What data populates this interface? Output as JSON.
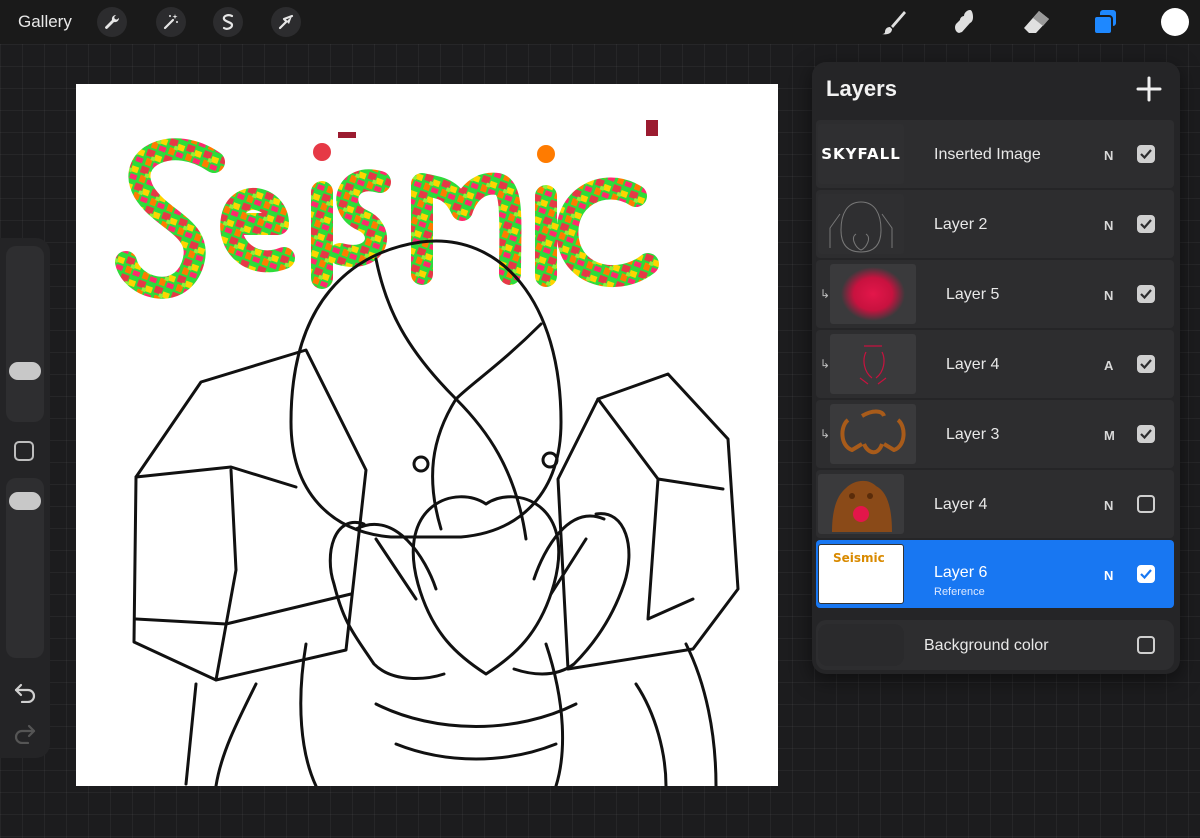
{
  "topbar": {
    "gallery_label": "Gallery",
    "left_tools": [
      "wrench-icon",
      "magic-wand-icon",
      "selection-icon",
      "transform-arrow-icon"
    ],
    "right_tools": [
      "brush-icon",
      "smudge-icon",
      "eraser-icon",
      "layers-icon"
    ],
    "layers_active_color": "#1e88ff",
    "current_color": "#ffffff"
  },
  "canvas": {
    "title_art": "Seismic",
    "title_colors": [
      "#e63946",
      "#ff2a6d",
      "#2ddc3a",
      "#ffd400",
      "#ff7b00"
    ]
  },
  "sidebar": {
    "undo_icon": "undo-icon",
    "redo_icon": "redo-icon"
  },
  "layers_panel": {
    "title": "Layers",
    "add_icon": "plus-icon",
    "layers": [
      {
        "name": "Inserted Image",
        "blend": "N",
        "visible": true,
        "clipped": false,
        "thumb_text": "SKYFALL"
      },
      {
        "name": "Layer 2",
        "blend": "N",
        "visible": true,
        "clipped": false
      },
      {
        "name": "Layer 5",
        "blend": "N",
        "visible": true,
        "clipped": true
      },
      {
        "name": "Layer 4",
        "blend": "A",
        "visible": true,
        "clipped": true
      },
      {
        "name": "Layer 3",
        "blend": "M",
        "visible": true,
        "clipped": true
      },
      {
        "name": "Layer 4",
        "blend": "N",
        "visible": false,
        "clipped": false
      },
      {
        "name": "Layer 6",
        "subtitle": "Reference",
        "blend": "N",
        "visible": true,
        "clipped": false,
        "selected": true,
        "thumb_text": "Seismic"
      }
    ],
    "background": {
      "name": "Background color",
      "visible": false
    }
  }
}
